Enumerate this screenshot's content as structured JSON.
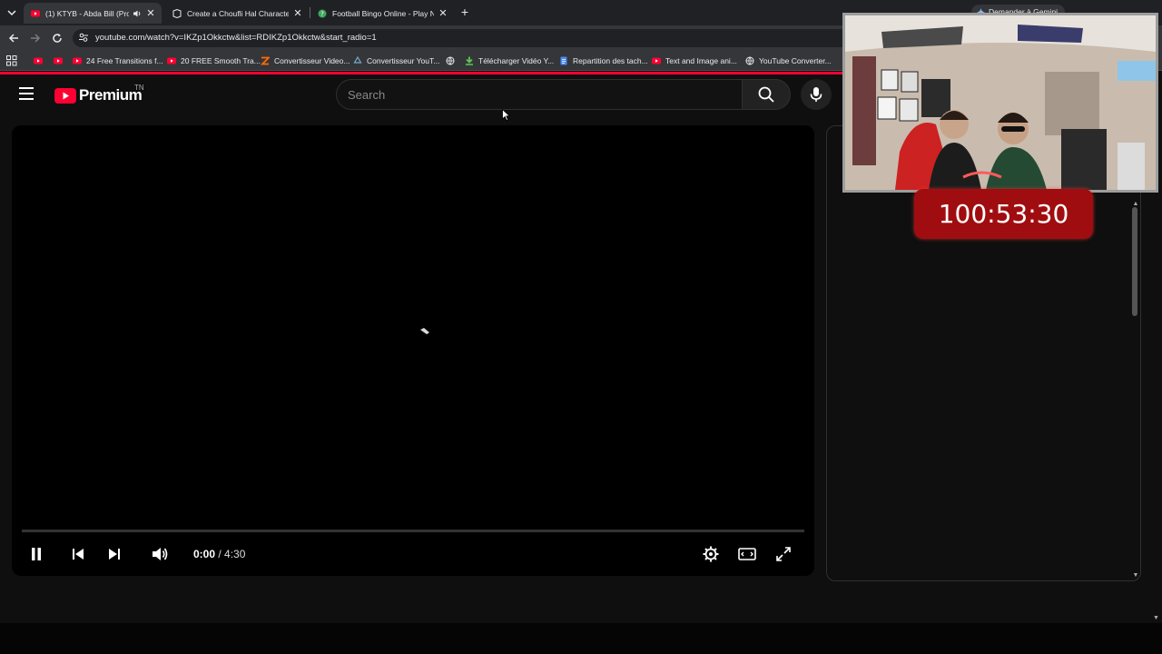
{
  "browser": {
    "tabs": [
      {
        "title": "(1) KTYB - Abda Bill (Prod B",
        "active": true,
        "favicon": "youtube-icon",
        "audio": true
      },
      {
        "title": "Create a Choufli Hal Character",
        "active": false,
        "favicon": "page-icon"
      },
      {
        "title": "Football Bingo Online - Play N",
        "active": false,
        "favicon": "green-circle-icon"
      }
    ],
    "new_tab": "+",
    "gemini_label": "Demander à Gemini",
    "url": "youtube.com/watch?v=IKZp1Okkctw&list=RDIKZp1Okkctw&start_radio=1",
    "bookmarks": [
      {
        "label": "",
        "icon": "youtube-icon"
      },
      {
        "label": "",
        "icon": "youtube-icon"
      },
      {
        "label": "24 Free Transitions f...",
        "icon": "youtube-icon"
      },
      {
        "label": "20 FREE Smooth Tra...",
        "icon": "youtube-icon"
      },
      {
        "label": "Convertisseur Video...",
        "icon": "z-icon"
      },
      {
        "label": "Convertisseur YouT...",
        "icon": "recycle-icon"
      },
      {
        "label": "",
        "icon": "globe-icon"
      },
      {
        "label": "Télécharger Vidéo Y...",
        "icon": "download-icon"
      },
      {
        "label": "Repartition des tach...",
        "icon": "docs-icon"
      },
      {
        "label": "Text and Image ani...",
        "icon": "youtube-icon"
      },
      {
        "label": "YouTube Converter...",
        "icon": "globe-icon"
      }
    ]
  },
  "youtube": {
    "logo_text": "Premium",
    "country_code": "TN",
    "search_placeholder": "Search",
    "player": {
      "current_time": "0:00",
      "separator": " / ",
      "duration": "4:30",
      "progress": 0.0
    }
  },
  "overlay": {
    "timer": "100:53:30"
  },
  "colors": {
    "accent": "#ff0033",
    "timer_bg": "#a00d10",
    "chrome_dark": "#202124",
    "chrome_toolbar": "#35363a"
  }
}
